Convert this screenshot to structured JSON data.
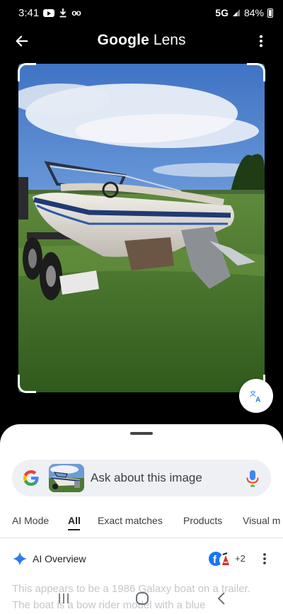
{
  "status_bar": {
    "time": "3:41",
    "network": "5G",
    "battery": "84%"
  },
  "header": {
    "title_brand": "Google",
    "title_product": "Lens",
    "back_icon": "arrow-back-icon",
    "more_icon": "more-vert-icon"
  },
  "search": {
    "placeholder": "Ask about this image"
  },
  "tabs": [
    {
      "label": "AI Mode",
      "active": false
    },
    {
      "label": "All",
      "active": true
    },
    {
      "label": "Exact matches",
      "active": false
    },
    {
      "label": "Products",
      "active": false
    },
    {
      "label": "Visual m",
      "active": false
    }
  ],
  "ai_overview": {
    "title": "AI Overview",
    "source_count": "+2",
    "text": "This appears to be a 1986 Galaxy boat on a trailer. The boat is a bow rider model with a blue"
  },
  "colors": {
    "accent": "#1a73e8",
    "sheet_bg": "#ffffff",
    "search_bg": "#eef0f3"
  }
}
